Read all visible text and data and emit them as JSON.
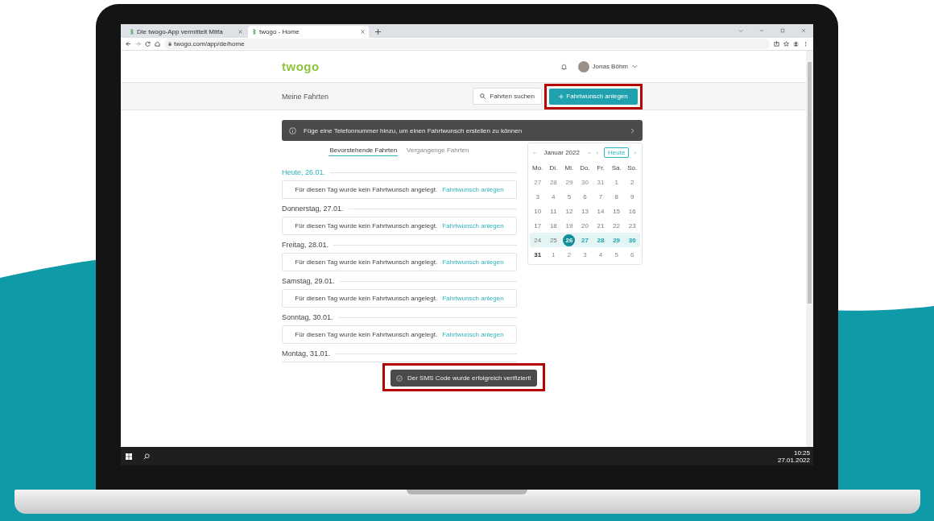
{
  "browser": {
    "tabs": [
      {
        "title": "Die twogo-App vermittelt Mitfa",
        "selected": false
      },
      {
        "title": "twogo - Home",
        "selected": true
      }
    ],
    "url": "twogo.com/app/de/home"
  },
  "header": {
    "logo": "twogo",
    "user_name": "Jonas Böhm"
  },
  "toolbar": {
    "title": "Meine Fahrten",
    "search_label": "Fahrten suchen",
    "create_button": {
      "label": "Fahrtwunsch anlegen",
      "highlighted": true
    }
  },
  "notice": "Füge eine Telefonnummer hinzu, um einen Fahrtwunsch erstellen zu können",
  "tabs": [
    {
      "label": "Bevorstehende Fahrten",
      "selected": true
    },
    {
      "label": "Vergangenge Fahrten",
      "selected": false
    }
  ],
  "days": [
    {
      "heading": "Heute, 26.01.",
      "today": true,
      "message": "Für diesen Tag wurde kein Fahrtwunsch angelegt.",
      "link": "Fahrtwunsch anlegen"
    },
    {
      "heading": "Donnerstag, 27.01.",
      "today": false,
      "message": "Für diesen Tag wurde kein Fahrtwunsch angelegt.",
      "link": "Fahrtwunsch anlegen"
    },
    {
      "heading": "Freitag, 28.01.",
      "today": false,
      "message": "Für diesen Tag wurde kein Fahrtwunsch angelegt.",
      "link": "Fahrtwunsch anlegen"
    },
    {
      "heading": "Samstag, 29.01.",
      "today": false,
      "message": "Für diesen Tag wurde kein Fahrtwunsch angelegt.",
      "link": "Fahrtwunsch anlegen"
    },
    {
      "heading": "Sonntag, 30.01.",
      "today": false,
      "message": "Für diesen Tag wurde kein Fahrtwunsch angelegt.",
      "link": "Fahrtwunsch anlegen"
    },
    {
      "heading": "Montag, 31.01.",
      "today": false
    }
  ],
  "calendar": {
    "month": "Januar 2022",
    "today_button": "Heute",
    "weekdays": [
      "Mo.",
      "Di.",
      "Mi.",
      "Do.",
      "Fr.",
      "Sa.",
      "So."
    ],
    "weeks": [
      {
        "highlighted": false,
        "days": [
          {
            "label": "27",
            "kind": "other"
          },
          {
            "label": "28",
            "kind": "other"
          },
          {
            "label": "29",
            "kind": "other"
          },
          {
            "label": "30",
            "kind": "other"
          },
          {
            "label": "31",
            "kind": "other"
          },
          {
            "label": "1",
            "kind": "past"
          },
          {
            "label": "2",
            "kind": "past"
          }
        ]
      },
      {
        "highlighted": false,
        "days": [
          {
            "label": "3",
            "kind": "past"
          },
          {
            "label": "4",
            "kind": "past"
          },
          {
            "label": "5",
            "kind": "past"
          },
          {
            "label": "6",
            "kind": "past"
          },
          {
            "label": "7",
            "kind": "past"
          },
          {
            "label": "8",
            "kind": "past"
          },
          {
            "label": "9",
            "kind": "past"
          }
        ]
      },
      {
        "highlighted": false,
        "days": [
          {
            "label": "10",
            "kind": "past"
          },
          {
            "label": "11",
            "kind": "past"
          },
          {
            "label": "12",
            "kind": "past"
          },
          {
            "label": "13",
            "kind": "past"
          },
          {
            "label": "14",
            "kind": "past"
          },
          {
            "label": "15",
            "kind": "past"
          },
          {
            "label": "16",
            "kind": "past"
          }
        ]
      },
      {
        "highlighted": false,
        "days": [
          {
            "label": "17",
            "kind": "past"
          },
          {
            "label": "18",
            "kind": "past"
          },
          {
            "label": "19",
            "kind": "past"
          },
          {
            "label": "20",
            "kind": "past"
          },
          {
            "label": "21",
            "kind": "past"
          },
          {
            "label": "22",
            "kind": "past"
          },
          {
            "label": "23",
            "kind": "past"
          }
        ]
      },
      {
        "highlighted": true,
        "days": [
          {
            "label": "24",
            "kind": "past"
          },
          {
            "label": "25",
            "kind": "past"
          },
          {
            "label": "26",
            "kind": "today"
          },
          {
            "label": "27",
            "kind": "range"
          },
          {
            "label": "28",
            "kind": "range"
          },
          {
            "label": "29",
            "kind": "range"
          },
          {
            "label": "30",
            "kind": "range"
          }
        ]
      },
      {
        "highlighted": false,
        "days": [
          {
            "label": "31",
            "kind": "future"
          },
          {
            "label": "1",
            "kind": "other"
          },
          {
            "label": "2",
            "kind": "other"
          },
          {
            "label": "3",
            "kind": "other"
          },
          {
            "label": "4",
            "kind": "other"
          },
          {
            "label": "5",
            "kind": "other"
          },
          {
            "label": "6",
            "kind": "other"
          }
        ]
      }
    ]
  },
  "toast": {
    "message": "Der SMS Code wurde erfolgreich verifiziert!",
    "highlighted": true
  },
  "taskbar": {
    "time": "10:25",
    "date": "27.01.2022"
  }
}
